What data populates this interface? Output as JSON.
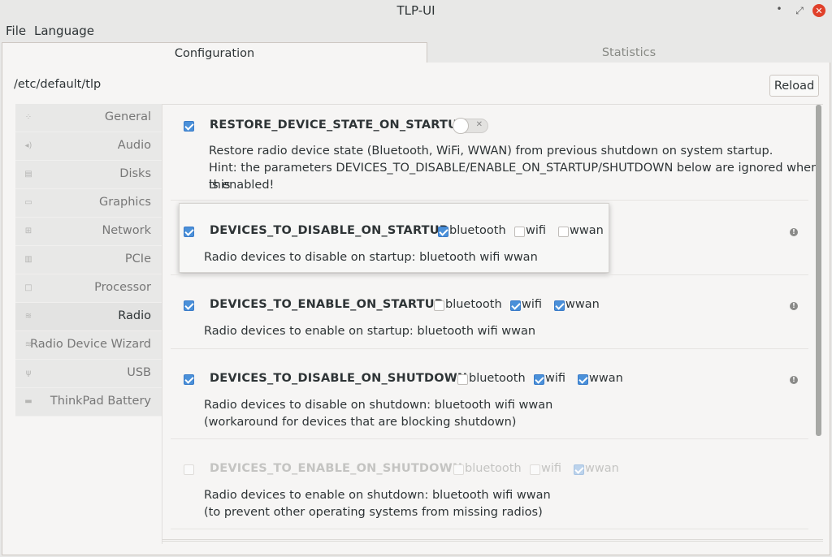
{
  "window": {
    "title": "TLP-UI",
    "min": "•",
    "max": "⤢",
    "close": "✕"
  },
  "menu": {
    "file": "File",
    "language": "Language"
  },
  "tabs": {
    "configuration": "Configuration",
    "statistics": "Statistics"
  },
  "config_path": "/etc/default/tlp",
  "reload_label": "Reload",
  "sidebar": {
    "items": [
      {
        "label": "General",
        "icon": "general-icon"
      },
      {
        "label": "Audio",
        "icon": "audio-icon"
      },
      {
        "label": "Disks",
        "icon": "disks-icon"
      },
      {
        "label": "Graphics",
        "icon": "graphics-icon"
      },
      {
        "label": "Network",
        "icon": "network-icon"
      },
      {
        "label": "PCIe",
        "icon": "pcie-icon"
      },
      {
        "label": "Processor",
        "icon": "processor-icon"
      },
      {
        "label": "Radio",
        "icon": "radio-icon"
      },
      {
        "label": "Radio Device Wizard",
        "icon": "wizard-icon"
      },
      {
        "label": "USB",
        "icon": "usb-icon"
      },
      {
        "label": "ThinkPad Battery",
        "icon": "battery-icon"
      }
    ],
    "selected": "Radio"
  },
  "settings": {
    "restore": {
      "name": "RESTORE_DEVICE_STATE_ON_STARTUP",
      "enabled": true,
      "toggle_on": false,
      "desc1": "Restore radio device state (Bluetooth, WiFi, WWAN) from previous shutdown on system startup.",
      "desc2": "Hint: the parameters DEVICES_TO_DISABLE/ENABLE_ON_STARTUP/SHUTDOWN below are ignored when this",
      "desc3": "is enabled!"
    },
    "disable_startup": {
      "name": "DEVICES_TO_DISABLE_ON_STARTUP",
      "enabled": true,
      "options": {
        "bluetooth": "bluetooth",
        "wifi": "wifi",
        "wwan": "wwan"
      },
      "checked": {
        "bluetooth": true,
        "wifi": false,
        "wwan": false
      },
      "desc1": "Radio devices to disable on startup: bluetooth wifi wwan"
    },
    "enable_startup": {
      "name": "DEVICES_TO_ENABLE_ON_STARTUP",
      "enabled": true,
      "options": {
        "bluetooth": "bluetooth",
        "wifi": "wifi",
        "wwan": "wwan"
      },
      "checked": {
        "bluetooth": false,
        "wifi": true,
        "wwan": true
      },
      "desc1": "Radio devices to enable on startup: bluetooth wifi wwan"
    },
    "disable_shutdown": {
      "name": "DEVICES_TO_DISABLE_ON_SHUTDOWN",
      "enabled": true,
      "options": {
        "bluetooth": "bluetooth",
        "wifi": "wifi",
        "wwan": "wwan"
      },
      "checked": {
        "bluetooth": false,
        "wifi": true,
        "wwan": true
      },
      "desc1": "Radio devices to disable on shutdown: bluetooth wifi wwan",
      "desc2": "(workaround for devices that are blocking shutdown)"
    },
    "enable_shutdown": {
      "name": "DEVICES_TO_ENABLE_ON_SHUTDOWN",
      "enabled": false,
      "options": {
        "bluetooth": "bluetooth",
        "wifi": "wifi",
        "wwan": "wwan"
      },
      "checked": {
        "bluetooth": false,
        "wifi": false,
        "wwan": true
      },
      "desc1": "Radio devices to enable on shutdown: bluetooth wifi wwan",
      "desc2": "(to prevent other operating systems from missing radios)"
    }
  },
  "colors": {
    "accent": "#4a90d9",
    "close": "#e0402a",
    "background": "#f6f5f4"
  }
}
